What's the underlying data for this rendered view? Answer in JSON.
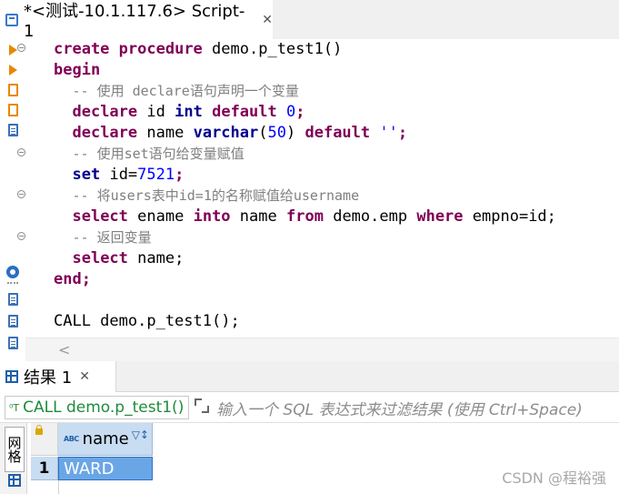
{
  "editor_tab": {
    "title": "*<测试-10.1.117.6> Script-1",
    "close": "✕"
  },
  "code_lines": [
    [
      "create procedure demo.p_test1()"
    ],
    [
      "begin"
    ],
    [
      "  -- 使用 declare语句声明一个变量"
    ],
    [
      "  declare id int default 0;"
    ],
    [
      "  declare name varchar(50) default '';"
    ],
    [
      "  -- 使用set语句给变量赋值"
    ],
    [
      "  set id=7521;"
    ],
    [
      "  -- 将users表中id=1的名称赋值给username"
    ],
    [
      "  select ename into name from demo.emp where empno=id;"
    ],
    [
      "  -- 返回变量"
    ],
    [
      "  select name;"
    ],
    [
      "end;"
    ],
    [
      ""
    ],
    [
      "CALL demo.p_test1();"
    ]
  ],
  "tokens": {
    "l0": [
      "create",
      "procedure",
      "demo.p_test1()"
    ],
    "l1": [
      "begin"
    ],
    "l2": [
      "-- 使用 declare语句声明一个变量"
    ],
    "l3": [
      "declare",
      "id",
      "int",
      "default",
      "0",
      ";"
    ],
    "l4": [
      "declare",
      "name",
      "varchar",
      "(",
      "50",
      ")",
      "default",
      "''",
      ";"
    ],
    "l5": [
      "-- 使用set语句给变量赋值"
    ],
    "l6": [
      "set",
      "id=",
      "7521",
      ";"
    ],
    "l7": [
      "-- 将users表中id=1的名称赋值给username"
    ],
    "l8": [
      "select",
      "ename",
      "into",
      "name",
      "from",
      "demo.emp",
      "where",
      "empno=id;"
    ],
    "l9": [
      "-- 返回变量"
    ],
    "l10": [
      "select",
      "name;"
    ],
    "l11": [
      "end;"
    ],
    "l13": [
      "CALL demo.p_test1();"
    ]
  },
  "hscroll": {
    "arrow": "<"
  },
  "results": {
    "tab_label": "结果 1",
    "close": "✕",
    "query_text": "CALL demo.p_test1()",
    "filter_placeholder": "输入一个 SQL 表达式来过滤结果 (使用 Ctrl+Space)",
    "side_tab": "网格",
    "column_type_icon": "ABC",
    "columns": [
      "name"
    ],
    "rows": [
      {
        "num": "1",
        "cells": [
          "WARD"
        ]
      }
    ]
  },
  "watermark": "CSDN @程裕强",
  "colors": {
    "keyword": "#7f0055",
    "number": "#0000ff",
    "string": "#2a00ff",
    "comment": "#808080",
    "selected_cell": "#6aa6e6"
  }
}
